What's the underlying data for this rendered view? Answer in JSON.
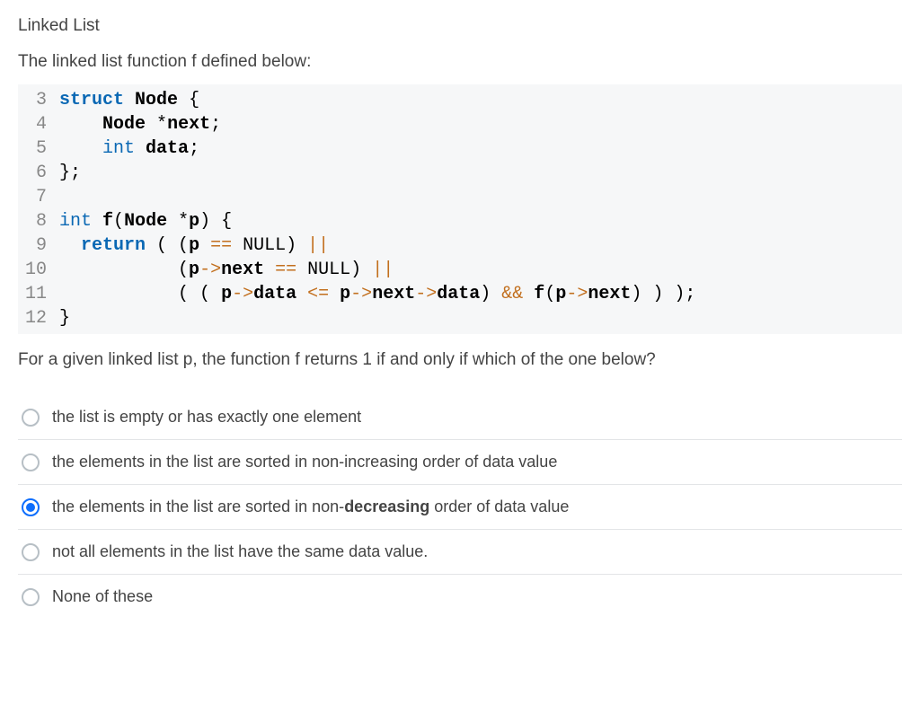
{
  "heading": "Linked List",
  "intro": "The linked list function f defined below:",
  "code": {
    "lines": [
      {
        "no": "3",
        "html": "<span class='kw-struct'>struct</span> <span class='kw-ident'>Node</span> <span class='kw-punct'>{</span>"
      },
      {
        "no": "4",
        "html": "    <span class='kw-ident'>Node</span> <span class='kw-punct'>*</span><span class='kw-member'>next</span><span class='kw-punct'>;</span>"
      },
      {
        "no": "5",
        "html": "    <span class='kw-type'>int</span> <span class='kw-member'>data</span><span class='kw-punct'>;</span>"
      },
      {
        "no": "6",
        "html": "<span class='kw-punct'>};</span>"
      },
      {
        "no": "7",
        "html": ""
      },
      {
        "no": "8",
        "html": "<span class='kw-type'>int</span> <span class='kw-ident'>f</span><span class='kw-punct'>(</span><span class='kw-ident'>Node</span> <span class='kw-punct'>*</span><span class='kw-member'>p</span><span class='kw-punct'>) {</span>"
      },
      {
        "no": "9",
        "html": "  <span class='kw-return'>return</span> <span class='kw-punct'>( (</span><span class='kw-member'>p</span> <span class='kw-op'>==</span> <span class='kw-null'>NULL</span><span class='kw-punct'>)</span> <span class='kw-op'>||</span>"
      },
      {
        "no": "10",
        "html": "           <span class='kw-punct'>(</span><span class='kw-member'>p</span><span class='kw-op'>-&gt;</span><span class='kw-member'>next</span> <span class='kw-op'>==</span> <span class='kw-null'>NULL</span><span class='kw-punct'>)</span> <span class='kw-op'>||</span>"
      },
      {
        "no": "11",
        "html": "           <span class='kw-punct'>( (</span> <span class='kw-member'>p</span><span class='kw-op'>-&gt;</span><span class='kw-member'>data</span> <span class='kw-op'>&lt;=</span> <span class='kw-member'>p</span><span class='kw-op'>-&gt;</span><span class='kw-member'>next</span><span class='kw-op'>-&gt;</span><span class='kw-member'>data</span><span class='kw-punct'>)</span> <span class='kw-op'>&amp;&amp;</span> <span class='kw-ident'>f</span><span class='kw-punct'>(</span><span class='kw-member'>p</span><span class='kw-op'>-&gt;</span><span class='kw-member'>next</span><span class='kw-punct'>) ) );</span>"
      },
      {
        "no": "12",
        "html": "<span class='kw-punct'>}</span>"
      }
    ]
  },
  "question": "For a given linked list p, the function f returns 1 if and only if which of the one below?",
  "options": [
    {
      "html": "the list is empty or has exactly one element",
      "selected": false
    },
    {
      "html": "the elements in the list are sorted in non-increasing order of data value",
      "selected": false
    },
    {
      "html": "the elements in the list are sorted in non-<strong>decreasing</strong> order of data value",
      "selected": true
    },
    {
      "html": "not all elements in the list have the same data value.",
      "selected": false
    },
    {
      "html": "None of these",
      "selected": false
    }
  ]
}
